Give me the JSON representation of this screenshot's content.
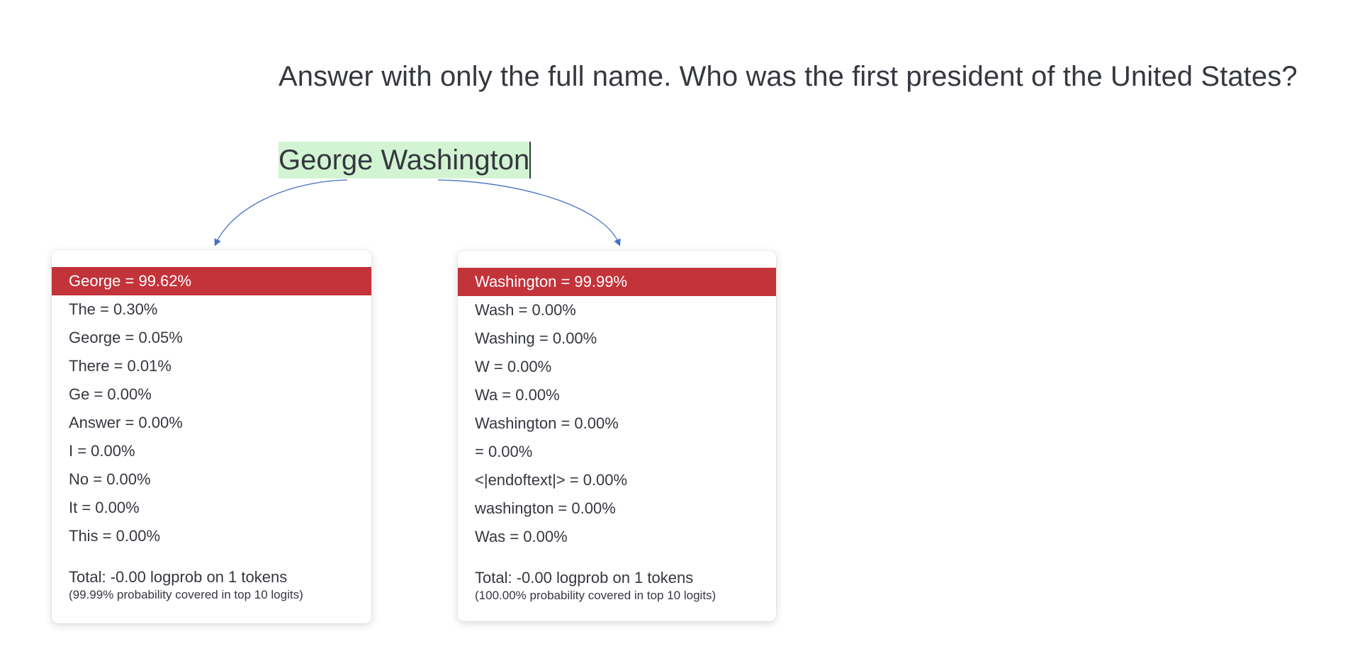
{
  "prompt": {
    "text": "Answer with only the full name. Who was the first president of the United States?"
  },
  "completion": {
    "tokens": [
      {
        "text": "George"
      },
      {
        "text": " Washington"
      }
    ],
    "highlight_color": "#d2f4d3"
  },
  "accent_colors": {
    "selected_row": "#c3333a",
    "arrow": "#4472c4"
  },
  "probability_panels": [
    {
      "token": "George",
      "rows": [
        {
          "label": "George = 99.62%",
          "selected": true
        },
        {
          "label": "The = 0.30%",
          "selected": false
        },
        {
          "label": "George = 0.05%",
          "selected": false
        },
        {
          "label": "There = 0.01%",
          "selected": false
        },
        {
          "label": "Ge = 0.00%",
          "selected": false
        },
        {
          "label": "Answer = 0.00%",
          "selected": false
        },
        {
          "label": "I = 0.00%",
          "selected": false
        },
        {
          "label": "No = 0.00%",
          "selected": false
        },
        {
          "label": "It = 0.00%",
          "selected": false
        },
        {
          "label": "This = 0.00%",
          "selected": false
        }
      ],
      "total": "Total: -0.00 logprob on 1 tokens",
      "coverage": "(99.99% probability covered in top 10 logits)"
    },
    {
      "token": "Washington",
      "rows": [
        {
          "label": "Washington = 99.99%",
          "selected": true
        },
        {
          "label": "Wash = 0.00%",
          "selected": false
        },
        {
          "label": "Washing = 0.00%",
          "selected": false
        },
        {
          "label": "W = 0.00%",
          "selected": false
        },
        {
          "label": "Wa = 0.00%",
          "selected": false
        },
        {
          "label": "Washington = 0.00%",
          "selected": false
        },
        {
          "label": "= 0.00%",
          "selected": false
        },
        {
          "label": "<|endoftext|> = 0.00%",
          "selected": false
        },
        {
          "label": "washington = 0.00%",
          "selected": false
        },
        {
          "label": "Was = 0.00%",
          "selected": false
        }
      ],
      "total": "Total: -0.00 logprob on 1 tokens",
      "coverage": "(100.00% probability covered in top 10 logits)"
    }
  ]
}
